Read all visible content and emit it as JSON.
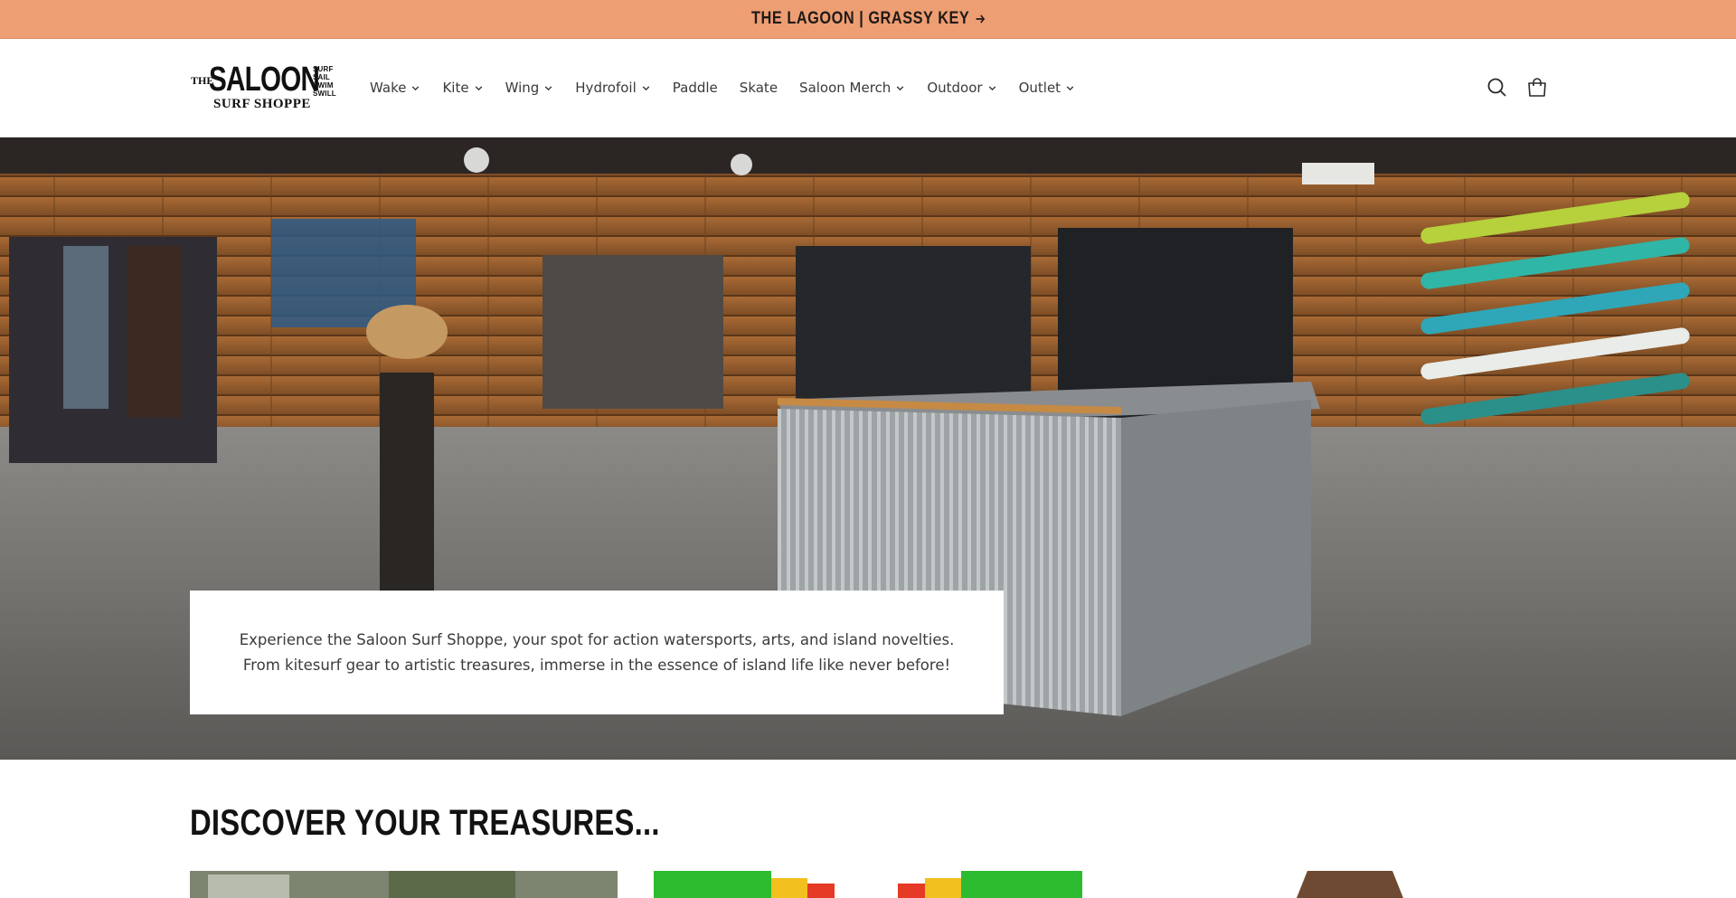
{
  "announcement": {
    "text": "THE LAGOON | GRASSY KEY",
    "arrow_icon": "arrow-right-icon"
  },
  "logo": {
    "the": "THE",
    "name": "SALOON",
    "side_words": [
      "SURF",
      "SAIL",
      "SWIM",
      "SWILL"
    ],
    "subtitle": "SURF SHOPPE"
  },
  "nav": {
    "items": [
      {
        "label": "Wake",
        "has_dropdown": true
      },
      {
        "label": "Kite",
        "has_dropdown": true
      },
      {
        "label": "Wing",
        "has_dropdown": true
      },
      {
        "label": "Hydrofoil",
        "has_dropdown": true
      },
      {
        "label": "Paddle",
        "has_dropdown": false
      },
      {
        "label": "Skate",
        "has_dropdown": false
      },
      {
        "label": "Saloon Merch",
        "has_dropdown": true
      },
      {
        "label": "Outdoor",
        "has_dropdown": true
      },
      {
        "label": "Outlet",
        "has_dropdown": true
      }
    ]
  },
  "header_icons": {
    "search": "search-icon",
    "cart": "cart-icon"
  },
  "hero": {
    "text": "Experience the Saloon Surf Shoppe, your spot for action watersports, arts, and island novelties. From kitesurf gear to artistic treasures, immerse in the essence of island life like never before!"
  },
  "collection": {
    "heading": "DISCOVER YOUR TREASURES..."
  },
  "colors": {
    "announcement_bg": "#ee9e73",
    "text": "#121212",
    "background": "#ffffff"
  }
}
